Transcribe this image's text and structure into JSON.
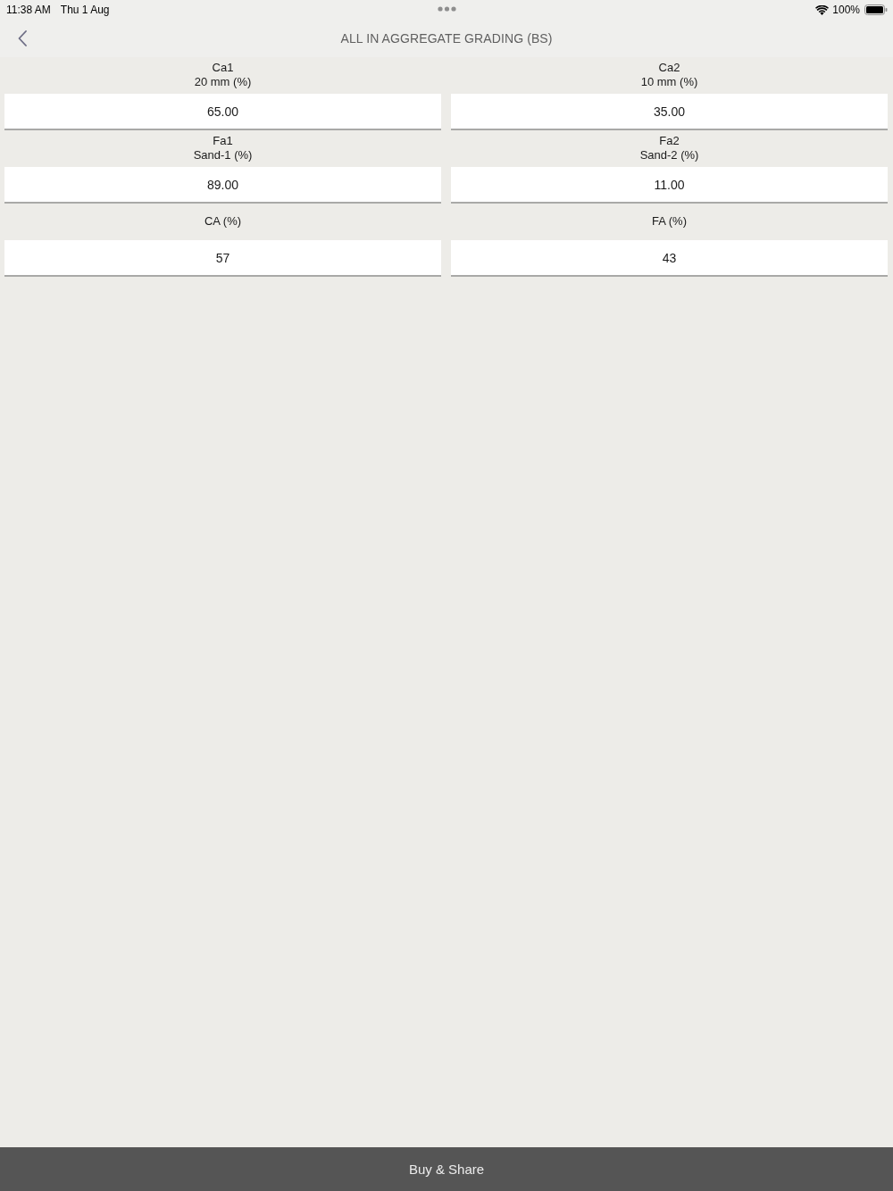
{
  "status_bar": {
    "time": "11:38 AM",
    "date": "Thu 1 Aug",
    "battery": "100%"
  },
  "nav": {
    "title": "ALL IN AGGREGATE GRADING (BS)"
  },
  "fields": [
    {
      "label_lines": [
        "Ca1",
        "20 mm (%)"
      ],
      "value": "65.00"
    },
    {
      "label_lines": [
        "Ca2",
        "10 mm (%)"
      ],
      "value": "35.00"
    },
    {
      "label_lines": [
        "Fa1",
        "Sand-1 (%)"
      ],
      "value": "89.00"
    },
    {
      "label_lines": [
        "Fa2",
        "Sand-2 (%)"
      ],
      "value": "11.00"
    },
    {
      "label_lines": [
        "CA (%)"
      ],
      "value": "57"
    },
    {
      "label_lines": [
        "FA (%)"
      ],
      "value": "43"
    }
  ],
  "footer_button": {
    "label": "Buy & Share"
  }
}
